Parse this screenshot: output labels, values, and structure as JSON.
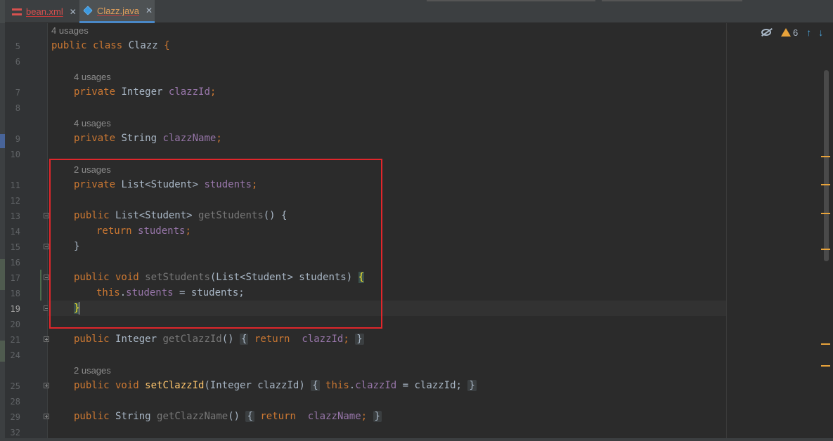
{
  "tabs": [
    {
      "label": "bean.xml",
      "icon": "xml-file-icon",
      "active": false
    },
    {
      "label": "Clazz.java",
      "icon": "java-class-icon",
      "active": true
    }
  ],
  "toolbar": {
    "warnings_count": "6",
    "reader_mode_icon": "eye-slash-icon",
    "warning_icon": "warning-triangle-icon",
    "prev_icon": "arrow-up-icon",
    "next_icon": "arrow-down-icon"
  },
  "hints": {
    "h0": "4 usages",
    "h1": "4 usages",
    "h2": "4 usages",
    "h3": "2 usages",
    "h4": "2 usages"
  },
  "line_numbers": [
    "5",
    "6",
    "7",
    "8",
    "9",
    "10",
    "11",
    "12",
    "13",
    "14",
    "15",
    "16",
    "17",
    "18",
    "19",
    "20",
    "21",
    "24",
    "25",
    "28",
    "29",
    "32"
  ],
  "code": {
    "l5": {
      "kw1": "public class ",
      "name": "Clazz ",
      "brace": "{"
    },
    "l7": {
      "kw": "private ",
      "type": "Integer ",
      "field": "clazzId",
      "end": ";"
    },
    "l9": {
      "kw": "private ",
      "type": "String ",
      "field": "clazzName",
      "end": ";"
    },
    "l11": {
      "kw": "private ",
      "type": "List<Student> ",
      "field": "students",
      "end": ";"
    },
    "l13": {
      "kw": "public ",
      "type": "List<Student> ",
      "method": "getStudents",
      "rest": "() {"
    },
    "l14": {
      "kw": "return ",
      "field": "students",
      "end": ";"
    },
    "l15": {
      "brace": "}"
    },
    "l17": {
      "kw": "public void ",
      "method": "setStudents",
      "rest": "(List<Student> students) ",
      "brace": "{"
    },
    "l18": {
      "kw": "this",
      "dot": ".",
      "field": "students",
      "rest": " = students;"
    },
    "l19": {
      "brace": "}"
    },
    "l21": {
      "kw": "public ",
      "type": "Integer ",
      "method": "getClazzId",
      "paren": "()",
      "ob": "{",
      "kw2": " return ",
      "field": "clazzId",
      "end": ";",
      "cb": "}"
    },
    "l25": {
      "kw": "public void ",
      "method": "setClazzId",
      "args": "(Integer clazzId)",
      "ob": "{",
      "kw2": " this",
      "dot": ".",
      "field": "clazzId",
      "rest": " = clazzId;",
      "cb": "}"
    },
    "l29": {
      "kw": "public ",
      "type": "String ",
      "method": "getClazzName",
      "paren": "()",
      "ob": "{",
      "kw2": " return ",
      "field": "clazzName",
      "end": ";",
      "cb": "}"
    }
  }
}
